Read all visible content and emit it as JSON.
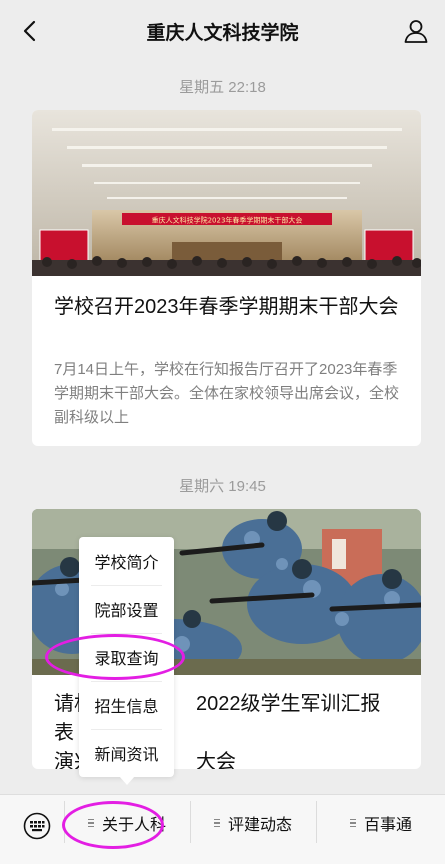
{
  "header": {
    "title": "重庆人文科技学院",
    "back_icon": "back-chevron-icon",
    "profile_icon": "person-icon"
  },
  "feed": {
    "messages": [
      {
        "time": "星期五 22:18",
        "title": "学校召开2023年春季学期期末干部大会",
        "description": "7月14日上午，学校在行知报告厅召开了2023年春季学期期末干部大会。全体在家校领导出席会议，全校副科级以上",
        "banner_text": "重庆人文科技学院2023年春季学期期末干部大会"
      },
      {
        "time": "星期六 19:45",
        "title_start": "请机",
        "title_end": "2022级学生军训汇报表",
        "title_line2_start": "演兴",
        "title_line2_end": "大会"
      }
    ]
  },
  "popup_menu": {
    "items": [
      "学校简介",
      "院部设置",
      "录取查询",
      "招生信息",
      "新闻资讯"
    ]
  },
  "bottom_bar": {
    "keyboard_icon": "keyboard-icon",
    "tabs": [
      "关于人科",
      "评建动态",
      "百事通"
    ]
  },
  "colors": {
    "background": "#ededed",
    "annotation": "#e31ee3",
    "banner_red": "#c8102e"
  }
}
